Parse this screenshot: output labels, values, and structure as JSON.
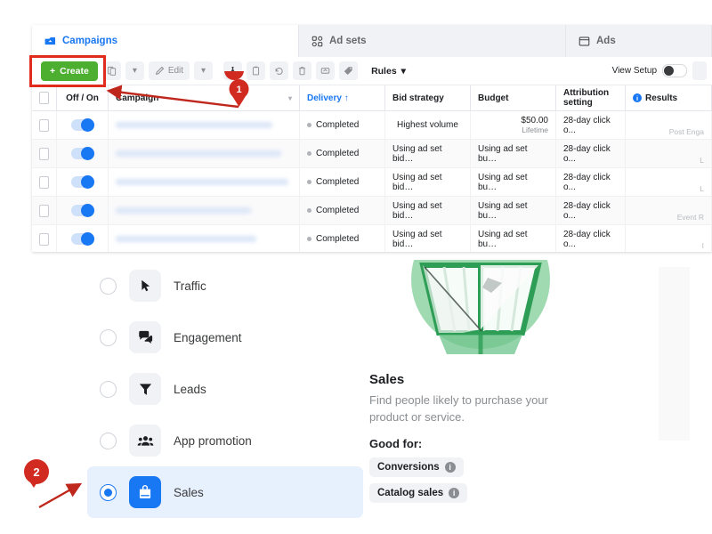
{
  "tabs": [
    {
      "label": "Campaigns",
      "icon": "megaphone-icon",
      "active": true
    },
    {
      "label": "Ad sets",
      "icon": "adsets-grid-icon",
      "active": false
    },
    {
      "label": "Ads",
      "icon": "ads-window-icon",
      "active": false
    }
  ],
  "toolbar": {
    "create_label": "Create",
    "create_plus": "+",
    "duplicate_icon": "duplicate-icon",
    "duplicate_caret": "▾",
    "edit_label": "Edit",
    "edit_icon": "pencil-icon",
    "edit_caret": "▾",
    "ab_test_icon": "flask-icon",
    "copy_icon": "clipboard-icon",
    "undo_icon": "undo-icon",
    "delete_icon": "trash-icon",
    "export_icon": "export-icon",
    "tag_icon": "tag-icon",
    "rules_label": "Rules",
    "rules_caret": "▾",
    "view_setup_label": "View Setup",
    "view_setup_on": false
  },
  "table": {
    "headers": {
      "onoff": "Off / On",
      "campaign": "Campaign",
      "campaign_caret": "▾",
      "delivery": "Delivery ↑",
      "bid_strategy": "Bid strategy",
      "budget": "Budget",
      "attribution": "Attribution setting",
      "results": "Results",
      "results_info": "i"
    },
    "rows": [
      {
        "on": true,
        "name_redacted": true,
        "delivery": "Completed",
        "bid": "Highest volume",
        "budget": "$50.00",
        "budget_sub": "Lifetime",
        "attribution": "28-day click o...",
        "results": "Post Enga"
      },
      {
        "on": true,
        "name_redacted": true,
        "delivery": "Completed",
        "bid": "Using ad set bid…",
        "budget": "Using ad set bu…",
        "budget_sub": "",
        "attribution": "28-day click o...",
        "results": "L"
      },
      {
        "on": true,
        "name_redacted": true,
        "delivery": "Completed",
        "bid": "Using ad set bid…",
        "budget": "Using ad set bu…",
        "budget_sub": "",
        "attribution": "28-day click o...",
        "results": "L"
      },
      {
        "on": true,
        "name_redacted": true,
        "delivery": "Completed",
        "bid": "Using ad set bid…",
        "budget": "Using ad set bu…",
        "budget_sub": "",
        "attribution": "28-day click o...",
        "results": "Event R"
      },
      {
        "on": true,
        "name_redacted": true,
        "delivery": "Completed",
        "bid": "Using ad set bid…",
        "budget": "Using ad set bu…",
        "budget_sub": "",
        "attribution": "28-day click o...",
        "results": "I"
      }
    ]
  },
  "objectives": [
    {
      "label": "Traffic",
      "icon": "cursor-arrow-icon",
      "selected": false
    },
    {
      "label": "Engagement",
      "icon": "chat-bubbles-icon",
      "selected": false
    },
    {
      "label": "Leads",
      "icon": "funnel-icon",
      "selected": false
    },
    {
      "label": "App promotion",
      "icon": "people-group-icon",
      "selected": false
    },
    {
      "label": "Sales",
      "icon": "shopping-bag-icon",
      "selected": true
    }
  ],
  "detail": {
    "illustration": "green-shopping-basket-illustration",
    "title": "Sales",
    "description": "Find people likely to purchase your product or service.",
    "good_for_label": "Good for:",
    "chips": [
      {
        "label": "Conversions",
        "info": "i"
      },
      {
        "label": "Catalog sales",
        "info": "i"
      }
    ]
  },
  "annotations": [
    {
      "id": "1",
      "label": "1",
      "shape": "map-pin",
      "color": "#d12a20",
      "target": "create-button"
    },
    {
      "id": "2",
      "label": "2",
      "shape": "speech-bubble",
      "color": "#d12a20",
      "target": "objective-sales"
    }
  ],
  "colors": {
    "create_green": "#4caf2f",
    "annotation_red": "#e02b1d",
    "facebook_blue": "#1877f2",
    "selected_row_bg": "#e7f0fd"
  }
}
